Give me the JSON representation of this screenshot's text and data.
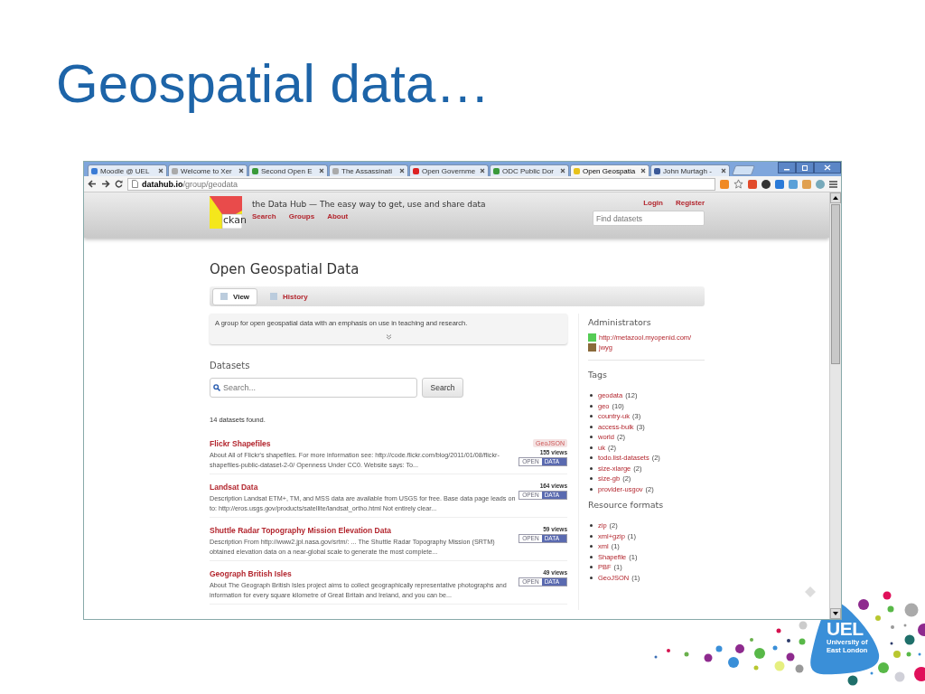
{
  "slide": {
    "title": "Geospatial data…",
    "logo": {
      "mark": "UEL",
      "line_1": "University of",
      "line_2": "East London"
    }
  },
  "browser": {
    "tabs": [
      {
        "label": "Moodle @ UEL",
        "selected": false,
        "kind": "cloud"
      },
      {
        "label": "Welcome to Xer",
        "selected": false,
        "kind": "page"
      },
      {
        "label": "Second Open E",
        "selected": false,
        "kind": "odc"
      },
      {
        "label": "The Assassinati",
        "selected": false,
        "kind": "page"
      },
      {
        "label": "Open Governme",
        "selected": false,
        "kind": "acrobat"
      },
      {
        "label": "ODC Public Dor",
        "selected": false,
        "kind": "odc"
      },
      {
        "label": "Open Geospatia",
        "selected": true,
        "kind": "ckan"
      },
      {
        "label": "John Murtagh -",
        "selected": false,
        "kind": "facebook"
      }
    ],
    "address": {
      "domain": "datahub.io",
      "path": "/group/geodata"
    }
  },
  "page": {
    "logo_text": "ckan",
    "tagline": "the Data Hub — The easy way to get, use and share data",
    "nav": [
      "Search",
      "Groups",
      "About"
    ],
    "account_links": [
      "Login",
      "Register"
    ],
    "site_search": {
      "placeholder": "Find datasets"
    },
    "heading": "Open Geospatial Data",
    "view_tabs": [
      {
        "label": "View",
        "selected": true
      },
      {
        "label": "History",
        "selected": false
      }
    ],
    "description": "A group for open geospatial data with an emphasis on use in teaching and research.",
    "datasets_heading": "Datasets",
    "dataset_search": {
      "placeholder": "Search...",
      "button": "Search"
    },
    "result_count": "14 datasets found.",
    "datasets": [
      {
        "title": "Flickr Shapefiles",
        "format": "GeoJSON",
        "views": "155 views",
        "badge": [
          "OPEN",
          "DATA"
        ],
        "description": "About All of Flickr's shapefiles. For more information see: http://code.flickr.com/blog/2011/01/08/flickr-shapefiles-public-dataset-2-0/ Openness Under CC0. Website says: To..."
      },
      {
        "title": "Landsat Data",
        "views": "164 views",
        "badge": [
          "OPEN",
          "DATA"
        ],
        "description": "Description Landsat ETM+, TM, and MSS data are available from USGS for free. Base data page leads on to: http://eros.usgs.gov/products/satellite/landsat_ortho.html Not entirely clear..."
      },
      {
        "title": "Shuttle Radar Topography Mission Elevation Data",
        "views": "59 views",
        "badge": [
          "OPEN",
          "DATA"
        ],
        "description": "Description From http://www2.jpl.nasa.gov/srtm/: ... The Shuttle Radar Topography Mission (SRTM) obtained elevation data on a near-global scale to generate the most complete..."
      },
      {
        "title": "Geograph British Isles",
        "views": "49 views",
        "badge": [
          "OPEN",
          "DATA"
        ],
        "description": "About The Geograph British Isles project aims to collect geographically representative photographs and information for every square kilometre of Great Britain and Ireland, and you can be..."
      }
    ],
    "sidebar": {
      "administrators_heading": "Administrators",
      "administrators": [
        {
          "name": "http://metazool.myopenid.com/",
          "kind": "identicon"
        },
        {
          "name": "jwyg",
          "kind": "photo"
        }
      ],
      "tags_heading": "Tags",
      "tags": [
        {
          "name": "geodata",
          "count": "(12)"
        },
        {
          "name": "geo",
          "count": "(10)"
        },
        {
          "name": "country-uk",
          "count": "(3)"
        },
        {
          "name": "access-bulk",
          "count": "(3)"
        },
        {
          "name": "world",
          "count": "(2)"
        },
        {
          "name": "uk",
          "count": "(2)"
        },
        {
          "name": "todo.list-datasets",
          "count": "(2)"
        },
        {
          "name": "size-xlarge",
          "count": "(2)"
        },
        {
          "name": "size-gb",
          "count": "(2)"
        },
        {
          "name": "provider-usgov",
          "count": "(2)"
        }
      ],
      "formats_heading": "Resource formats",
      "formats": [
        {
          "name": "zip",
          "count": "(2)"
        },
        {
          "name": "xml+gzip",
          "count": "(1)"
        },
        {
          "name": "xml",
          "count": "(1)"
        },
        {
          "name": "Shapefile",
          "count": "(1)"
        },
        {
          "name": "PBF",
          "count": "(1)"
        },
        {
          "name": "GeoJSON",
          "count": "(1)"
        }
      ]
    }
  }
}
